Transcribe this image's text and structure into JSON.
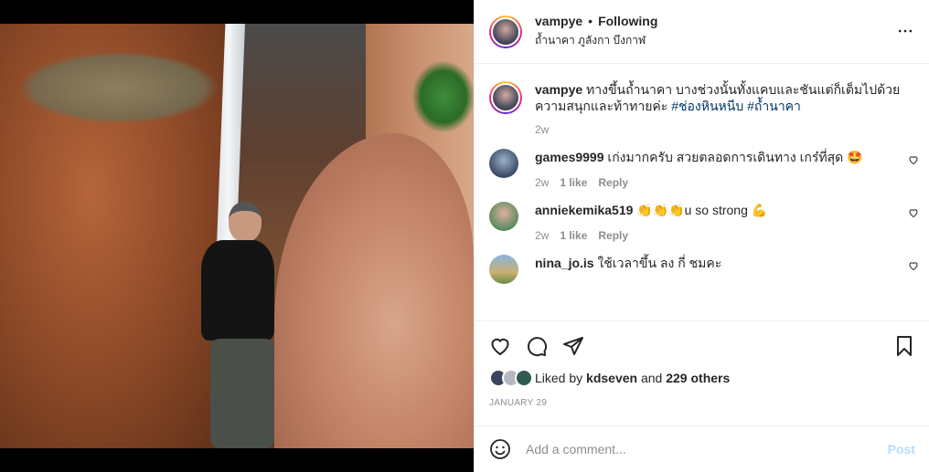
{
  "post": {
    "username": "vampye",
    "separator": "•",
    "follow_label": "Following",
    "location": "ถ้ำนาคา ภูลังกา บึงกาฬ"
  },
  "caption": {
    "username": "vampye",
    "text": "ทางขึ้นถ้ำนาคา บางช่วงนั้นทั้งแคบและชันแต่ก็เต็มไปด้วยความสนุกและท้าทายค่ะ",
    "tags": [
      "#ช่องหินหนีบ",
      "#ถ้ำนาคา"
    ],
    "age": "2w"
  },
  "comments": [
    {
      "username": "games9999",
      "text": "เก่งมากครับ สวยตลอดการเดินทาง เกร๋ที่สุด 🤩",
      "age": "2w",
      "likes": "1 like",
      "reply": "Reply"
    },
    {
      "username": "anniekemika519",
      "text": "👏👏👏u so strong 💪",
      "age": "2w",
      "likes": "1 like",
      "reply": "Reply"
    },
    {
      "username": "nina_jo.is",
      "text": "ใช้เวลาขึ้น ลง กี่ ชมคะ",
      "age": "",
      "likes": "",
      "reply": ""
    }
  ],
  "likes": {
    "prefix": "Liked by",
    "user": "kdseven",
    "middle": "and",
    "others": "229 others"
  },
  "date": "JANUARY 29",
  "add_comment": {
    "placeholder": "Add a comment...",
    "post_label": "Post"
  },
  "colors": {
    "link": "#00376b",
    "muted": "#8e8e8e",
    "post_disabled": "#b2dffc"
  }
}
